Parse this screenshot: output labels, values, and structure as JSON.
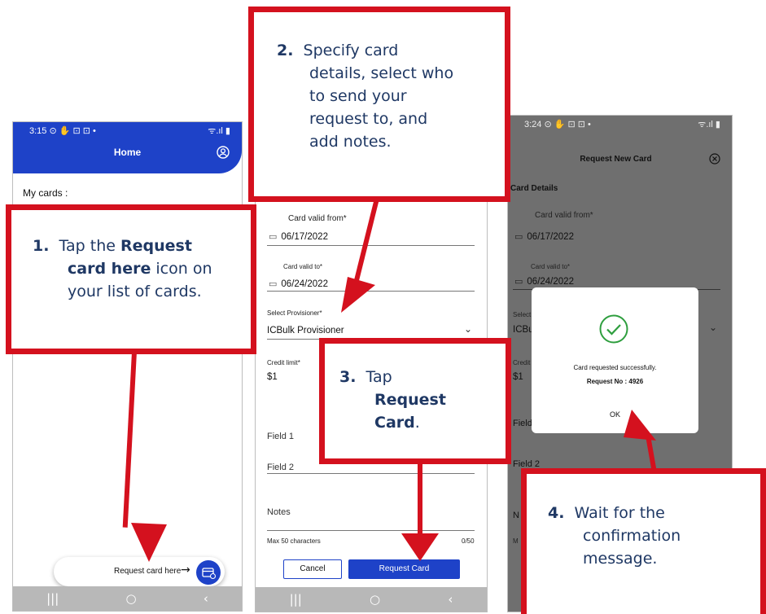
{
  "colors": {
    "accent": "#1e42c8",
    "callout_border": "#d4111e",
    "callout_text": "#1f3864"
  },
  "phone1": {
    "status_time": "3:15 ⊙ ✋ ⊡ ⊡ •",
    "status_right": "ᯤ.ıl ▮",
    "title": "Home",
    "profile_icon": "user-circle-icon",
    "my_cards": "My cards :",
    "fab_label": "Request card here",
    "fab_arrow": "→",
    "fab_icon": "card-request-icon",
    "nav": [
      "|||",
      "○",
      "‹"
    ]
  },
  "phone2": {
    "valid_from_label": "Card valid from*",
    "valid_from_value": "06/17/2022",
    "valid_to_label": "Card valid to*",
    "valid_to_value": "06/24/2022",
    "provisioner_label": "Select Provisioner*",
    "provisioner_value": "ICBulk Provisioner",
    "credit_label": "Credit limit*",
    "credit_value": "$1",
    "field1": "Field 1",
    "field2": "Field 2",
    "notes": "Notes",
    "max_chars": "Max 50 characters",
    "char_count": "0/50",
    "cancel": "Cancel",
    "request_card": "Request Card",
    "nav": [
      "|||",
      "○",
      "‹"
    ]
  },
  "phone3": {
    "status_time": "3:24 ⊙ ✋ ⊡ ⊡ •",
    "status_right": "ᯤ.ıl ▮",
    "title": "Request New Card",
    "close_icon": "close-circle-icon",
    "card_details": "Card Details",
    "valid_from_label": "Card valid from*",
    "valid_from_value": "06/17/2022",
    "valid_to_label": "Card valid to*",
    "valid_to_value": "06/24/2022",
    "select_label": "Select",
    "select_value": "ICBu",
    "credit_label": "Credit l",
    "credit_value": "$1",
    "field1": "Field",
    "field2": "Field 2",
    "notes": "N",
    "max": "M",
    "dialog_message": "Card requested successfully.",
    "dialog_request_no": "Request No : 4926",
    "dialog_ok": "OK"
  },
  "callouts": {
    "c1": {
      "num": "1.",
      "t1": "Tap the ",
      "b1": "Request",
      "b2": "card here",
      "t2": " icon on",
      "t3": "your list of cards."
    },
    "c2": {
      "num": "2.",
      "l1": "Specify card",
      "l2": "details, select who",
      "l3": "to send your",
      "l4": "request to, and",
      "l5": "add notes."
    },
    "c3": {
      "num": "3.",
      "l1": "Tap",
      "b1": "Request",
      "b2": "Card",
      "end": "."
    },
    "c4": {
      "num": "4.",
      "l1": "Wait for the",
      "l2": "confirmation",
      "l3": "message."
    }
  }
}
